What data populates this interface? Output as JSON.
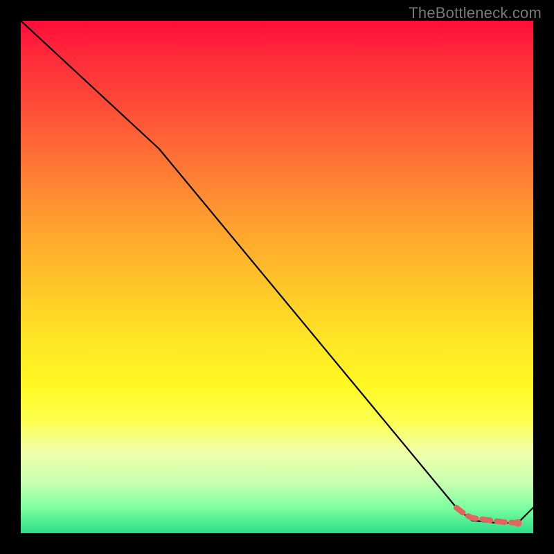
{
  "watermark": "TheBottleneck.com",
  "colors": {
    "background": "#000000",
    "line": "#000000",
    "marker": "#e1645e"
  },
  "chart_data": {
    "type": "line",
    "title": "",
    "xlabel": "",
    "ylabel": "",
    "xlim": [
      0,
      100
    ],
    "ylim": [
      0,
      100
    ],
    "grid": false,
    "legend": false,
    "series": [
      {
        "name": "curve",
        "x": [
          0,
          27,
          85,
          88,
          93,
          97,
          100
        ],
        "y": [
          100,
          75,
          5,
          2.5,
          2,
          2,
          5
        ]
      }
    ],
    "markers": {
      "name": "highlight-segment",
      "x": [
        85,
        86,
        87,
        88,
        89.5,
        91,
        92.5,
        94,
        95.5,
        97
      ],
      "y": [
        5,
        4.2,
        3.5,
        3,
        2.8,
        2.6,
        2.4,
        2.2,
        2.1,
        2
      ]
    },
    "annotations": []
  }
}
